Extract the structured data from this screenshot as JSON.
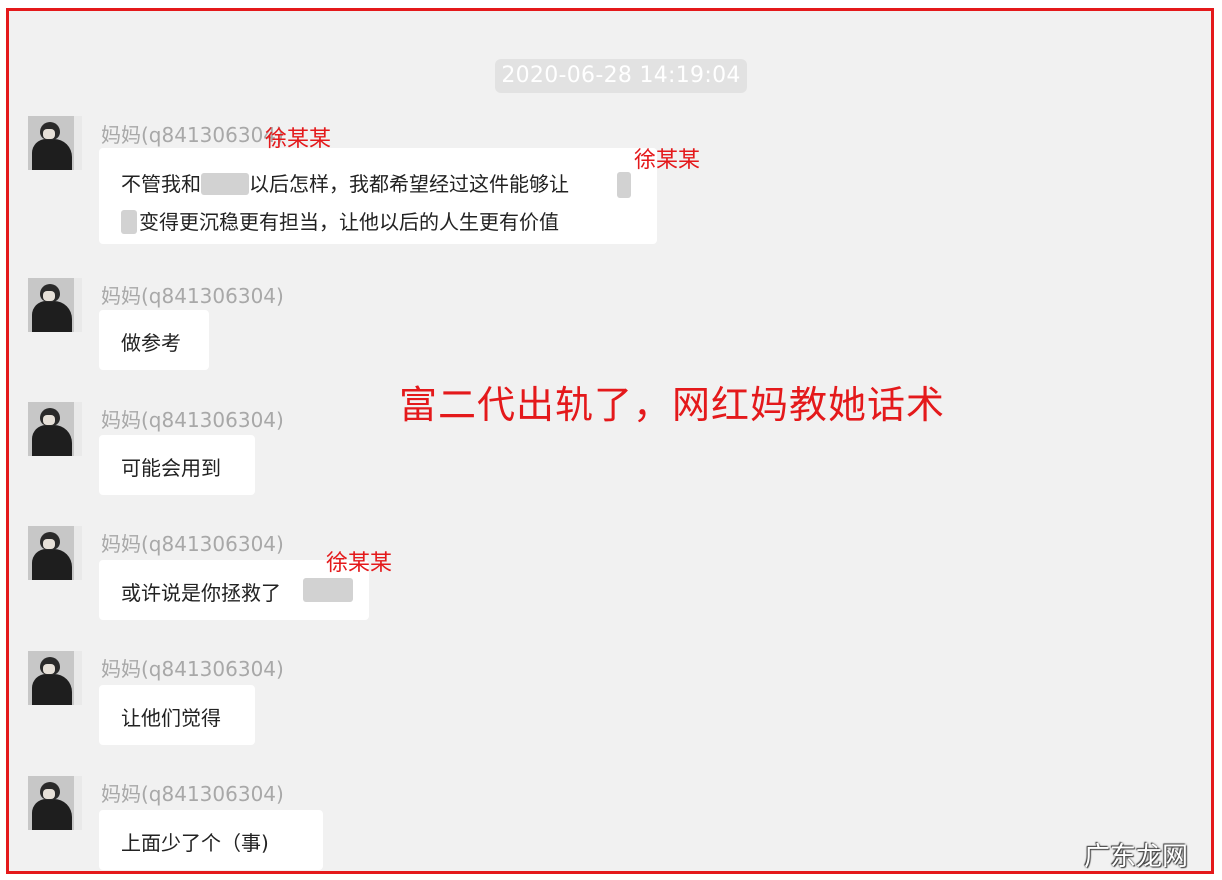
{
  "chat": {
    "timestamp": "2020-06-28 14:19:04",
    "messages": [
      {
        "sender": "妈妈(q841306304)",
        "line1_a": "不管我和",
        "line1_b": "以后怎样，我都希望经过这件能够让",
        "line2": "变得更沉稳更有担当，让他以后的人生更有价值"
      },
      {
        "sender": "妈妈(q841306304)",
        "text": "做参考"
      },
      {
        "sender": "妈妈(q841306304)",
        "text": "可能会用到"
      },
      {
        "sender": "妈妈(q841306304)",
        "text": "或许说是你拯救了"
      },
      {
        "sender": "妈妈(q841306304)",
        "text": "让他们觉得"
      },
      {
        "sender": "妈妈(q841306304)",
        "text": "上面少了个（事)"
      }
    ]
  },
  "annotations": {
    "name_label": "徐某某",
    "title": "富二代出轨了，网红妈教她话术",
    "color": "#e4191b"
  },
  "watermark": "广东龙网"
}
